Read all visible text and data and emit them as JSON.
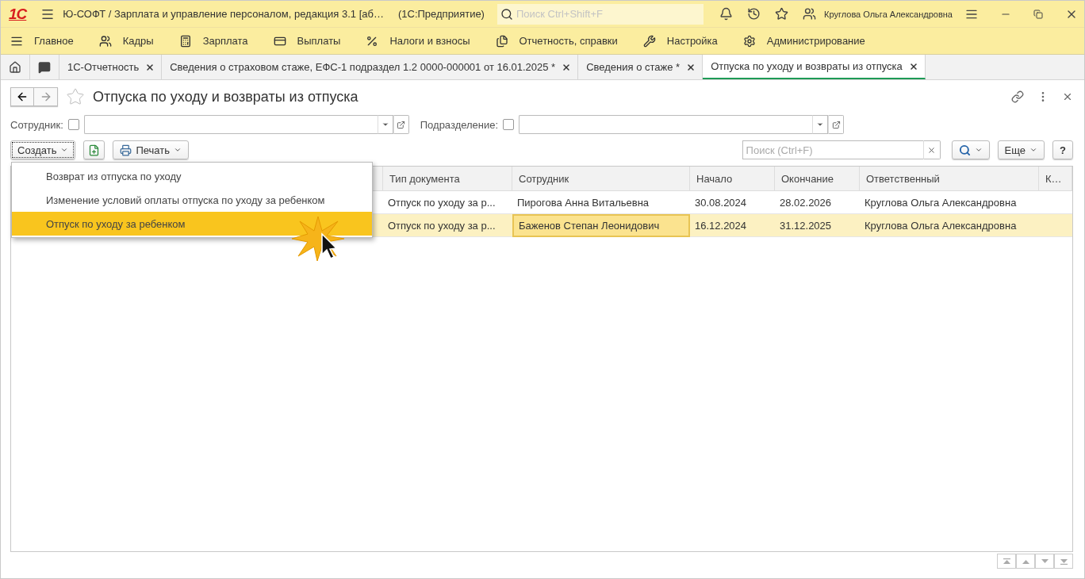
{
  "titlebar": {
    "logo": "1С",
    "title": "Ю-СОФТ / Зарплата и управление персоналом, редакция 3.1 [аб…",
    "mode": "(1С:Предприятие)",
    "search_placeholder": "Поиск Ctrl+Shift+F",
    "user": "Круглова Ольга Александровна"
  },
  "menu": [
    {
      "label": "Главное"
    },
    {
      "label": "Кадры"
    },
    {
      "label": "Зарплата"
    },
    {
      "label": "Выплаты"
    },
    {
      "label": "Налоги и взносы"
    },
    {
      "label": "Отчетность, справки"
    },
    {
      "label": "Настройка"
    },
    {
      "label": "Администрирование"
    }
  ],
  "tabs": [
    {
      "label": "1С-Отчетность",
      "selected": false
    },
    {
      "label": "Сведения о страховом стаже, ЕФС-1 подраздел 1.2 0000-000001 от 16.01.2025 *",
      "selected": false
    },
    {
      "label": "Сведения о стаже *",
      "selected": false
    },
    {
      "label": "Отпуска по уходу и возвраты из отпуска",
      "selected": true
    }
  ],
  "form": {
    "title": "Отпуска по уходу и возвраты из отпуска",
    "filters": [
      {
        "label": "Сотрудник:",
        "checked": false
      },
      {
        "label": "Подразделение:",
        "checked": false
      }
    ],
    "create_button": "Создать",
    "print_button": "Печать",
    "search_placeholder": "Поиск (Ctrl+F)",
    "more_button": "Еще",
    "help_button": "?"
  },
  "create_menu": [
    {
      "label": "Возврат из отпуска по уходу",
      "selected": false
    },
    {
      "label": "Изменение условий оплаты отпуска по уходу за ребенком",
      "selected": false
    },
    {
      "label": "Отпуск по уходу за ребенком",
      "selected": true
    }
  ],
  "table": {
    "columns": [
      "Тип документа",
      "Сотрудник",
      "Начало",
      "Окончание",
      "Ответственный",
      "К…"
    ],
    "rows": [
      {
        "selected": false,
        "cells": [
          {
            "text": "Отпуск по уходу за р...",
            "focused": false
          },
          {
            "text": "Пирогова Анна Витальевна",
            "focused": false
          },
          {
            "text": "30.08.2024",
            "focused": false
          },
          {
            "text": "28.02.2026",
            "focused": false
          },
          {
            "text": "Круглова Ольга Александровна",
            "focused": false
          },
          {
            "text": "",
            "focused": false
          }
        ]
      },
      {
        "selected": true,
        "cells": [
          {
            "text": "Отпуск по уходу за р...",
            "focused": false
          },
          {
            "text": "Баженов Степан Леонидович",
            "focused": true
          },
          {
            "text": "16.12.2024",
            "focused": false
          },
          {
            "text": "31.12.2025",
            "focused": false
          },
          {
            "text": "Круглова Ольга Александровна",
            "focused": false
          },
          {
            "text": "",
            "focused": false
          }
        ]
      }
    ]
  }
}
